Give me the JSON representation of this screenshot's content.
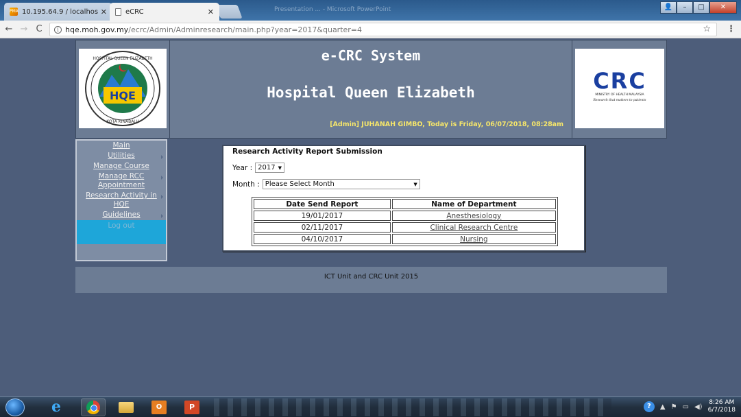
{
  "browser": {
    "tabs": [
      {
        "title": "10.195.64.9 / localhost / ",
        "icon": "pma-icon"
      },
      {
        "title": "eCRC",
        "icon": "page-icon"
      }
    ],
    "blurred_title": "Presentation ... - Microsoft PowerPoint",
    "url_host": "hqe.moh.gov.my",
    "url_path": "/ecrc/Admin/Adminresearch/main.php?year=2017&quarter=4"
  },
  "header": {
    "system_title": "e-CRC System",
    "hospital_title": "Hospital Queen Elizabeth",
    "welcome_text": "[Admin] JUHANAH GIMBO, Today is Friday, 06/07/2018, 08:28am",
    "left_logo_text": {
      "top": "HOSPITAL QUEEN ELIZABETH",
      "mid": "HQE",
      "bottom": "KOTA KINABALU"
    },
    "right_logo_text": {
      "mark": "CRC",
      "line1": "MINISTRY OF HEALTH MALAYSIA",
      "line2": "Research that matters to patients"
    }
  },
  "sidebar": {
    "items": [
      {
        "label": "Main",
        "has_arrow": false
      },
      {
        "label": "Utilities",
        "has_arrow": true
      },
      {
        "label": "Manage Course",
        "has_arrow": false
      },
      {
        "label": "Manage RCC Appointment",
        "has_arrow": true
      },
      {
        "label": "Research Activity in HQE",
        "has_arrow": true
      },
      {
        "label": "Guidelines",
        "has_arrow": true
      }
    ],
    "logout_label": "Log out"
  },
  "panel": {
    "title": "Research Activity Report Submission",
    "year_label": "Year :",
    "year_value": "2017",
    "month_label": "Month :",
    "month_value": "Please Select Month",
    "table": {
      "headers": [
        "Date Send Report",
        "Name of Department"
      ],
      "rows": [
        {
          "date": "19/01/2017",
          "department": "Anesthesiology"
        },
        {
          "date": "02/11/2017",
          "department": "Clinical Research Centre"
        },
        {
          "date": "04/10/2017",
          "department": "Nursing"
        }
      ]
    }
  },
  "footer": {
    "text": "ICT Unit and CRC Unit 2015"
  },
  "taskbar": {
    "time": "8:26 AM",
    "date": "6/7/2018"
  }
}
